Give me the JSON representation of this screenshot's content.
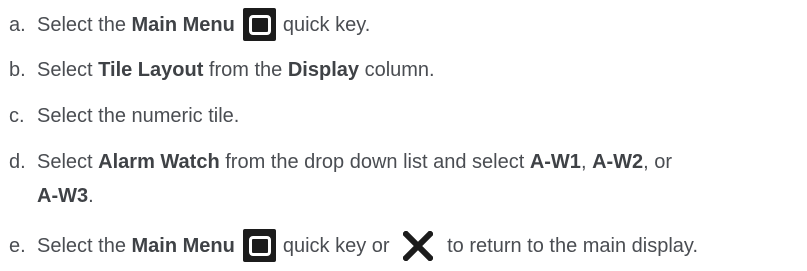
{
  "steps": [
    {
      "marker": "a.",
      "parts": [
        "Select the ",
        "Main Menu",
        "quick key."
      ]
    },
    {
      "marker": "b.",
      "parts": [
        "Select ",
        "Tile Layout",
        " from the ",
        "Display",
        " column."
      ]
    },
    {
      "marker": "c.",
      "parts": [
        "Select the numeric tile."
      ]
    },
    {
      "marker": "d.",
      "parts": [
        "Select ",
        "Alarm Watch",
        " from the drop down list and select ",
        "A-W1",
        ", ",
        "A-W2",
        ", or",
        "A-W3",
        "."
      ]
    },
    {
      "marker": "e.",
      "parts": [
        "Select the ",
        "Main Menu",
        "quick key or ",
        "to return to the main display."
      ]
    }
  ],
  "icons": {
    "main_menu": "main-menu-icon",
    "close": "close-x-icon"
  }
}
